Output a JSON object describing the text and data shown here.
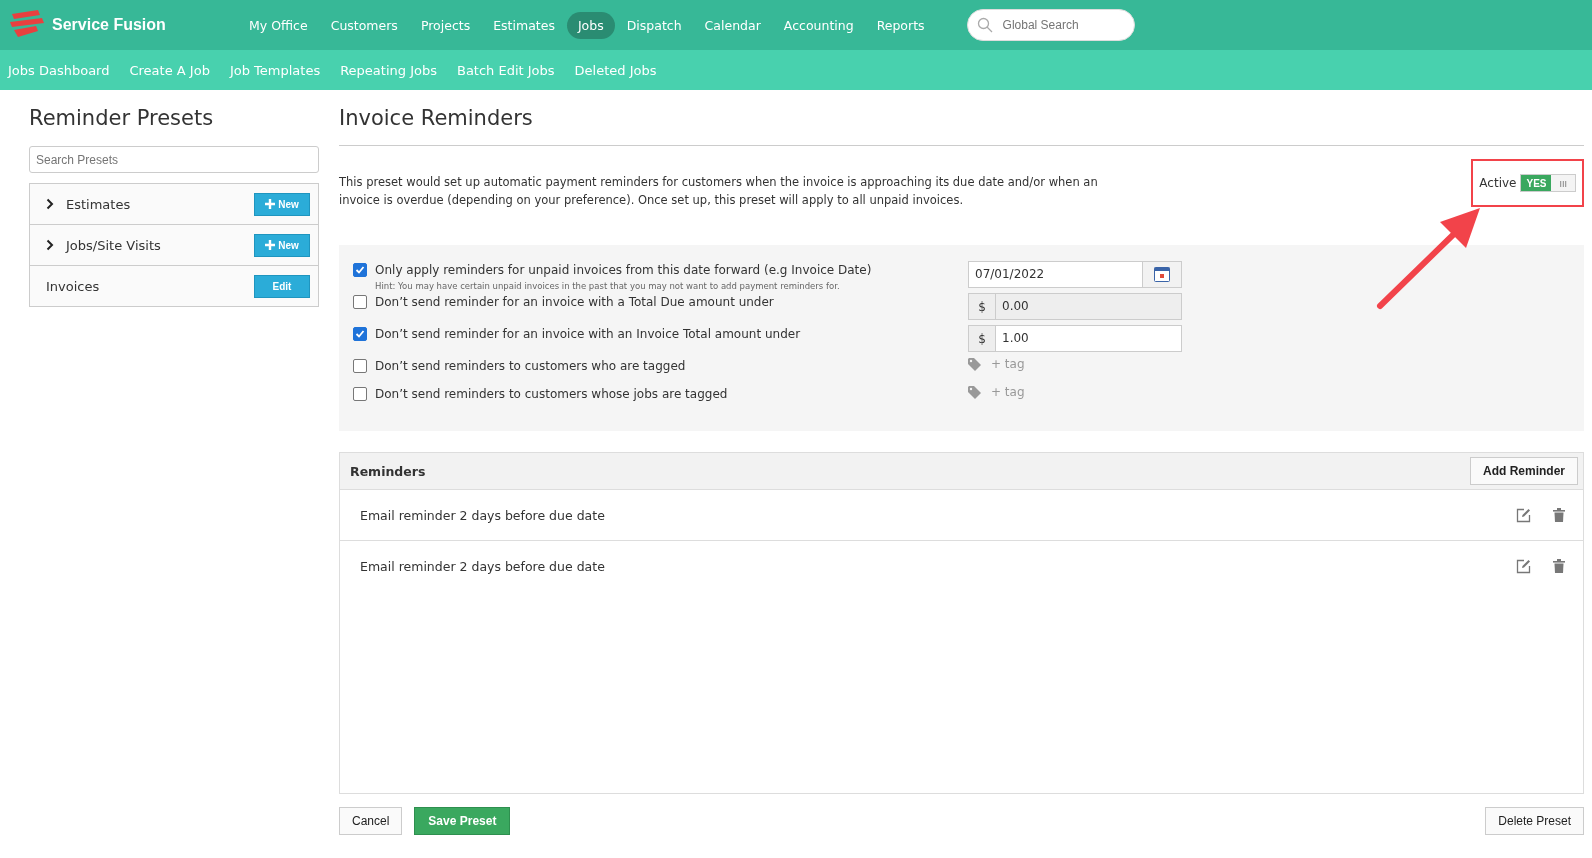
{
  "brand": {
    "name": "Service Fusion"
  },
  "nav": [
    {
      "label": "My Office",
      "selected": false
    },
    {
      "label": "Customers",
      "selected": false
    },
    {
      "label": "Projects",
      "selected": false
    },
    {
      "label": "Estimates",
      "selected": false
    },
    {
      "label": "Jobs",
      "selected": true
    },
    {
      "label": "Dispatch",
      "selected": false
    },
    {
      "label": "Calendar",
      "selected": false
    },
    {
      "label": "Accounting",
      "selected": false
    },
    {
      "label": "Reports",
      "selected": false
    }
  ],
  "global_search": {
    "placeholder": "Global Search"
  },
  "subnav": [
    "Jobs Dashboard",
    "Create A Job",
    "Job Templates",
    "Repeating Jobs",
    "Batch Edit Jobs",
    "Deleted Jobs"
  ],
  "sidebar": {
    "title": "Reminder Presets",
    "search": {
      "placeholder": "Search Presets"
    },
    "items": [
      {
        "label": "Estimates",
        "expandable": true,
        "button": "New",
        "kind": "new"
      },
      {
        "label": "Jobs/Site Visits",
        "expandable": true,
        "button": "New",
        "kind": "new"
      },
      {
        "label": "Invoices",
        "expandable": false,
        "button": "Edit",
        "kind": "edit"
      }
    ]
  },
  "main": {
    "title": "Invoice Reminders",
    "description": "This preset would set up automatic payment reminders for customers when the invoice is approaching its due date and/or when an invoice is overdue (depending on your preference). Once set up, this preset will apply to all unpaid invoices.",
    "active": {
      "label": "Active",
      "on": true,
      "on_text": "YES",
      "handle": "III"
    },
    "options": [
      {
        "kind": "date",
        "checked": true,
        "label": "Only apply reminders for unpaid invoices from this date forward (e.g Invoice Date)",
        "hint": "Hint: You may have certain unpaid invoices in the past that you may not want to add payment reminders for.",
        "value": "07/01/2022"
      },
      {
        "kind": "money",
        "checked": false,
        "label": "Don’t send reminder for an invoice with a Total Due amount under",
        "prefix": "$",
        "value": "0.00",
        "disabled": true
      },
      {
        "kind": "money",
        "checked": true,
        "label": "Don’t send reminder for an invoice with an Invoice Total amount under",
        "prefix": "$",
        "value": "1.00",
        "disabled": false
      },
      {
        "kind": "tag",
        "checked": false,
        "label": "Don’t send reminders to customers who are tagged",
        "value": "+ tag"
      },
      {
        "kind": "tag",
        "checked": false,
        "label": "Don’t send reminders to customers whose jobs are tagged",
        "value": "+ tag"
      }
    ],
    "reminders": {
      "title": "Reminders",
      "add_button": "Add Reminder",
      "rows": [
        "Email reminder 2 days before due date",
        "Email reminder 2 days before due date"
      ]
    },
    "buttons": {
      "cancel": "Cancel",
      "save": "Save Preset",
      "delete": "Delete Preset"
    }
  }
}
